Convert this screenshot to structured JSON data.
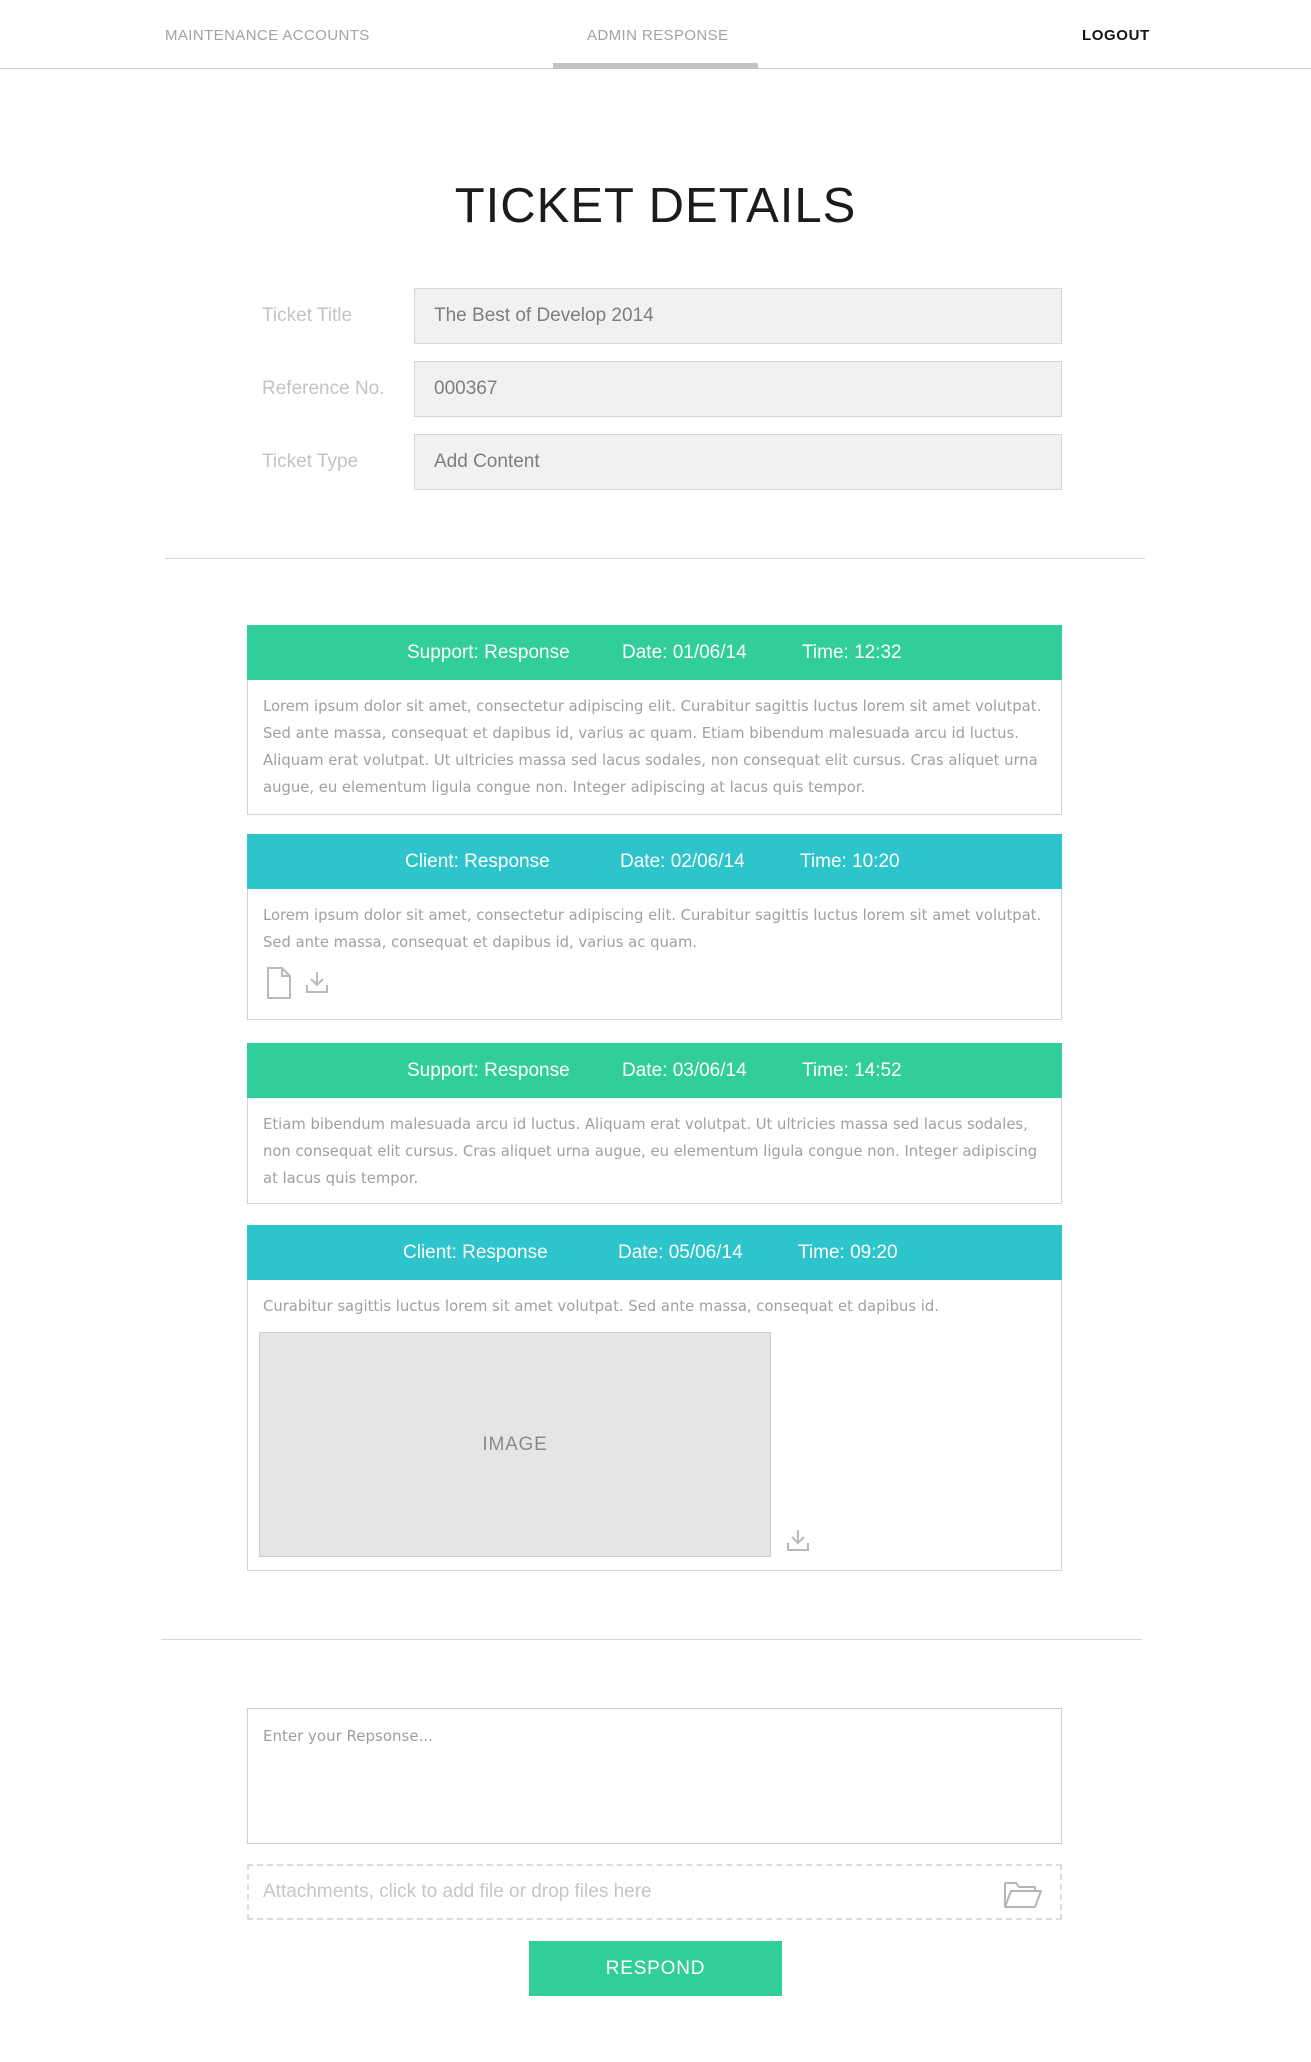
{
  "nav": {
    "maintenance_accounts": "MAINTENANCE ACCOUNTS",
    "admin_response": "ADMIN RESPONSE",
    "logout": "LOGOUT",
    "active_tab": "admin_response"
  },
  "page_title": "TICKET DETAILS",
  "fields": [
    {
      "label": "Ticket Title",
      "value": "The Best of Develop 2014"
    },
    {
      "label": "Reference No.",
      "value": "000367"
    },
    {
      "label": "Ticket Type",
      "value": "Add Content"
    }
  ],
  "messages": [
    {
      "author": "Support: Response",
      "date": "Date: 01/06/14",
      "time": "Time: 12:32",
      "kind": "support",
      "lines": [
        "Lorem ipsum dolor sit amet, consectetur adipiscing elit. Curabitur sagittis luctus lorem sit amet volutpat.",
        "Sed ante massa, consequat et dapibus id, varius ac quam. Etiam bibendum malesuada arcu id luctus.",
        "Aliquam erat volutpat. Ut ultricies massa sed lacus sodales, non consequat elit cursus. Cras aliquet urna",
        "augue, eu elementum ligula congue non. Integer adipiscing at lacus quis tempor."
      ]
    },
    {
      "author": "Client: Response",
      "date": "Date: 02/06/14",
      "time": "Time: 10:20",
      "kind": "client",
      "lines": [
        "Lorem ipsum dolor sit amet, consectetur adipiscing elit. Curabitur sagittis luctus lorem sit amet volutpat.",
        "Sed ante massa, consequat et dapibus id, varius ac quam."
      ],
      "attachment_icons": [
        "document-icon",
        "download-icon"
      ]
    },
    {
      "author": "Support: Response",
      "date": "Date: 03/06/14",
      "time": "Time: 14:52",
      "kind": "support",
      "lines": [
        "Etiam bibendum malesuada arcu id luctus. Aliquam erat volutpat. Ut ultricies massa sed lacus sodales,",
        "non consequat elit cursus. Cras aliquet urna augue, eu elementum ligula congue non. Integer adipiscing",
        "at lacus quis tempor."
      ]
    },
    {
      "author": "Client: Response",
      "date": "Date: 05/06/14",
      "time": "Time: 09:20",
      "kind": "client",
      "lines": [
        "Curabitur sagittis luctus lorem sit amet volutpat. Sed ante massa, consequat et dapibus id."
      ],
      "image_label": "IMAGE",
      "attachment_icons": [
        "download-icon"
      ]
    }
  ],
  "response": {
    "placeholder": "Enter your Repsonse...",
    "attachments_label": "Attachments, click to add file or drop files here",
    "attachments_icon": "folder-open-icon",
    "submit_label": "RESPOND"
  },
  "colors": {
    "support_header": "#31cd9a",
    "client_header": "#2ec4cc",
    "respond_button": "#31cd9a"
  }
}
